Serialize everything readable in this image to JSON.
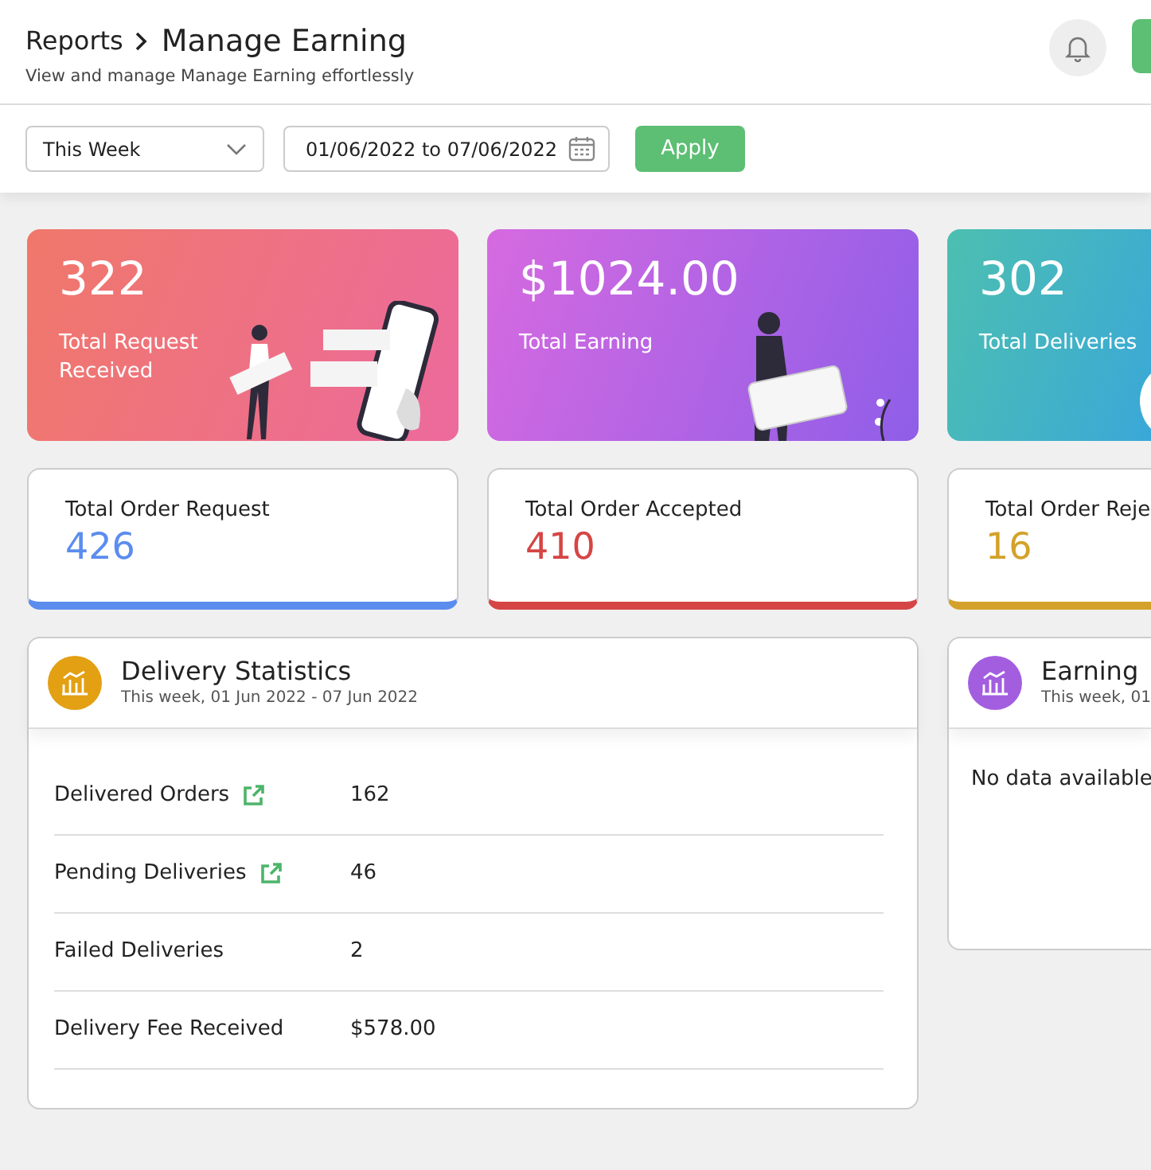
{
  "header": {
    "breadcrumb": "Reports",
    "title": "Manage Earning",
    "subtitle": "View and manage Manage Earning effortlessly"
  },
  "filters": {
    "period": "This Week",
    "date_range": "01/06/2022 to 07/06/2022",
    "apply": "Apply"
  },
  "summary_cards": [
    {
      "kind": "request",
      "value": "322",
      "label": "Total Request Received"
    },
    {
      "kind": "earning",
      "value": "$1024.00",
      "label": "Total Earning"
    },
    {
      "kind": "deliveries",
      "value": "302",
      "label": "Total Deliveries"
    }
  ],
  "order_cards": [
    {
      "label": "Total Order Request",
      "value": "426",
      "color": "#5b8def"
    },
    {
      "label": "Total Order Accepted",
      "value": "410",
      "color": "#d64545"
    },
    {
      "label": "Total Order Reje",
      "value": "16",
      "color": "#d4a22a"
    }
  ],
  "delivery_statistics": {
    "title": "Delivery Statistics",
    "subtitle": "This week, 01 Jun 2022 - 07 Jun 2022",
    "rows": [
      {
        "label": "Delivered Orders",
        "link": true,
        "value": "162"
      },
      {
        "label": "Pending Deliveries",
        "link": true,
        "value": "46"
      },
      {
        "label": "Failed Deliveries",
        "link": false,
        "value": "2"
      },
      {
        "label": "Delivery Fee Received",
        "link": false,
        "value": "$578.00"
      }
    ]
  },
  "earning": {
    "title": "Earning",
    "subtitle": "This week, 01",
    "message": "No data available"
  }
}
